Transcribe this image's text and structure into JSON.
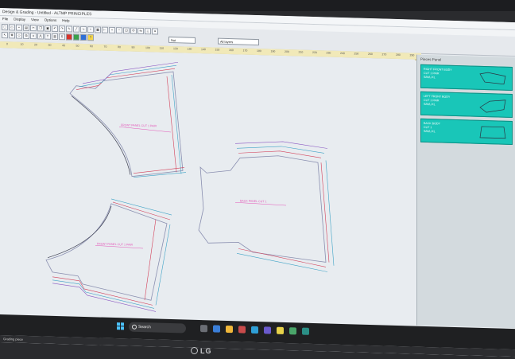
{
  "app": {
    "title": "Design & Grading - Untitled - ALTMP PRINCIPLES",
    "menu": [
      "File",
      "Display",
      "View",
      "Options",
      "Help"
    ],
    "selects": {
      "size": "Not",
      "layer": "All layers"
    }
  },
  "ruler": {
    "ticks": [
      "0",
      "10",
      "20",
      "30",
      "40",
      "50",
      "60",
      "70",
      "80",
      "90",
      "100",
      "110",
      "120",
      "130",
      "140",
      "150",
      "160",
      "170",
      "180",
      "190",
      "200",
      "210",
      "220",
      "230",
      "240",
      "250",
      "260",
      "270",
      "280",
      "290"
    ]
  },
  "pieces": [
    {
      "label": "FRONT PANEL CUT 1 PAIR",
      "lines": [
        "RIGHT FRONT BODY",
        "CUT 1 PAIR",
        "S/M/L/XL"
      ]
    },
    {
      "label": "BACK PANEL CUT 1",
      "lines": [
        "BACK BODY",
        "CUT 1",
        "S/M/L/XL"
      ]
    },
    {
      "label": "FRONT PANEL CUT 1 PAIR",
      "lines": [
        "LEFT FRONT BODY",
        "CUT 1 PAIR",
        "S/M/L/XL"
      ]
    }
  ],
  "panel": {
    "title": "Pieces Panel"
  },
  "taskbar": {
    "search": "Search"
  },
  "status": "Grading piece",
  "monitor": {
    "brand": "LG"
  }
}
